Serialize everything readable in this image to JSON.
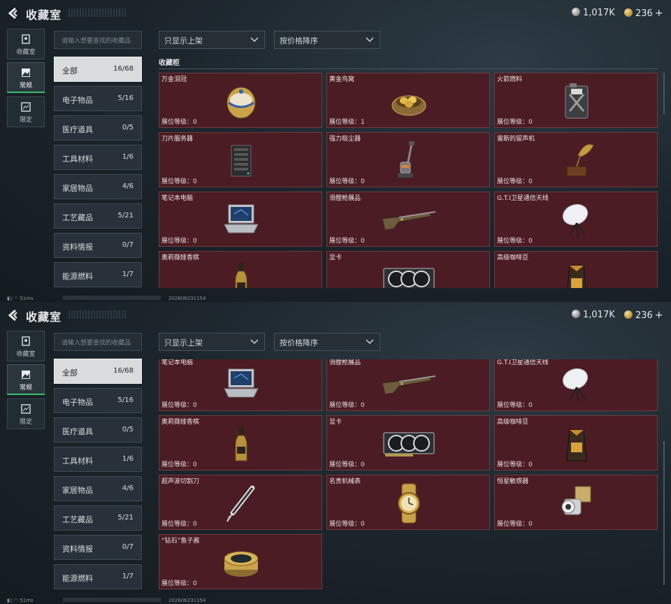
{
  "header": {
    "title": "收藏室",
    "silver": "1,017K",
    "gold": "236",
    "plus": "+"
  },
  "side_tabs": [
    {
      "label": "收藏室",
      "icon": "collection-icon"
    },
    {
      "label": "常规",
      "icon": "image-icon"
    },
    {
      "label": "限定",
      "icon": "landscape-icon"
    }
  ],
  "search": {
    "placeholder": "请输入想要查找的收藏品"
  },
  "filters": {
    "shelf": "只显示上架",
    "sort": "按价格降序"
  },
  "categories": [
    {
      "label": "全部",
      "count": "16/68"
    },
    {
      "label": "电子物品",
      "count": "5/16"
    },
    {
      "label": "医疗道具",
      "count": "0/5"
    },
    {
      "label": "工具材料",
      "count": "1/6"
    },
    {
      "label": "家居物品",
      "count": "4/6"
    },
    {
      "label": "工艺藏品",
      "count": "5/21"
    },
    {
      "label": "资料情报",
      "count": "0/7"
    },
    {
      "label": "能源燃料",
      "count": "1/7"
    }
  ],
  "grid_title": "收藏柜",
  "level_label": "展位等级：",
  "items": [
    {
      "name": "万金泪冠",
      "level": "0",
      "icon": "jeweled-egg-icon"
    },
    {
      "name": "黄金鸟窝",
      "level": "1",
      "icon": "golden-nest-icon"
    },
    {
      "name": "火箭燃料",
      "level": "0",
      "icon": "fuel-canister-icon"
    },
    {
      "name": "刀片服务器",
      "level": "0",
      "icon": "server-icon"
    },
    {
      "name": "强力吸尘器",
      "level": "0",
      "icon": "vacuum-icon"
    },
    {
      "name": "雷斯的留声机",
      "level": "0",
      "icon": "gramophone-icon"
    },
    {
      "name": "笔记本电脑",
      "level": "0",
      "icon": "laptop-icon"
    },
    {
      "name": "滑膛枪展品",
      "level": "0",
      "icon": "musket-icon"
    },
    {
      "name": "G.T.I卫星通信天线",
      "level": "0",
      "icon": "satellite-dish-icon"
    },
    {
      "name": "奥莉薇娅香槟",
      "level": "0",
      "icon": "champagne-icon"
    },
    {
      "name": "显卡",
      "level": "0",
      "icon": "graphics-card-icon"
    },
    {
      "name": "高级咖啡豆",
      "level": "0",
      "icon": "coffee-bag-icon"
    },
    {
      "name": "超声波切割刀",
      "level": "0",
      "icon": "ultrasonic-cutter-icon"
    },
    {
      "name": "名贵机械表",
      "level": "0",
      "icon": "watch-icon"
    },
    {
      "name": "恒星敏感器",
      "level": "0",
      "icon": "star-sensor-icon"
    },
    {
      "name": "“钻石”鱼子酱",
      "level": "0",
      "icon": "caviar-tin-icon"
    }
  ],
  "status": {
    "ping": "51ms",
    "timestamp": "20260623115​4"
  }
}
